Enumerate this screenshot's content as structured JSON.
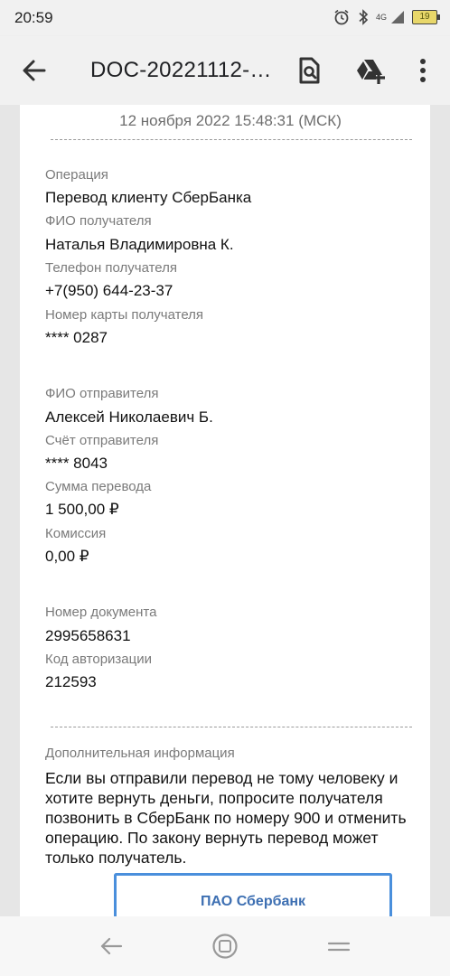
{
  "status_bar": {
    "time": "20:59",
    "network_label": "4G",
    "battery_level": "19",
    "icons": [
      "alarm-icon",
      "bluetooth-icon",
      "signal-icon",
      "battery-icon"
    ]
  },
  "app_bar": {
    "title": "DOC-20221112-…",
    "icons": [
      "back-arrow-icon",
      "document-search-icon",
      "drive-add-icon",
      "more-vert-icon"
    ]
  },
  "document": {
    "timestamp": "12 ноября 2022 15:48:31 (МСК)",
    "fields": [
      {
        "label": "Операция",
        "value": "Перевод клиенту СберБанка"
      },
      {
        "label": "ФИО получателя",
        "value": "Наталья Владимировна К."
      },
      {
        "label": "Телефон получателя",
        "value": "+7(950) 644-23-37"
      },
      {
        "label": "Номер карты получателя",
        "value": "**** 0287"
      },
      {
        "label": "ФИО отправителя",
        "value": "Алексей Николаевич Б."
      },
      {
        "label": "Счёт отправителя",
        "value": "**** 8043"
      },
      {
        "label": "Сумма перевода",
        "value": "1 500,00 ₽"
      },
      {
        "label": "Комиссия",
        "value": "0,00 ₽"
      },
      {
        "label": "Номер документа",
        "value": "2995658631"
      },
      {
        "label": "Код авторизации",
        "value": "212593"
      }
    ],
    "additional_info_label": "Дополнительная информация",
    "additional_info_text": "Если вы отправили перевод не тому человеку и хотите вернуть деньги, попросите получателя позвонить в СберБанк по номеру 900 и отменить операцию. По закону вернуть перевод может только получатель.",
    "stamp_title": "ПАО Сбербанк"
  },
  "nav_bar": {
    "icons": [
      "nav-back-icon",
      "nav-home-icon",
      "nav-recents-icon"
    ]
  },
  "colors": {
    "accent_blue": "#4a8fdc",
    "bank_text": "#3d6fb2",
    "label_gray": "#7a7a7a",
    "chrome_bg": "#f1f1f1"
  }
}
